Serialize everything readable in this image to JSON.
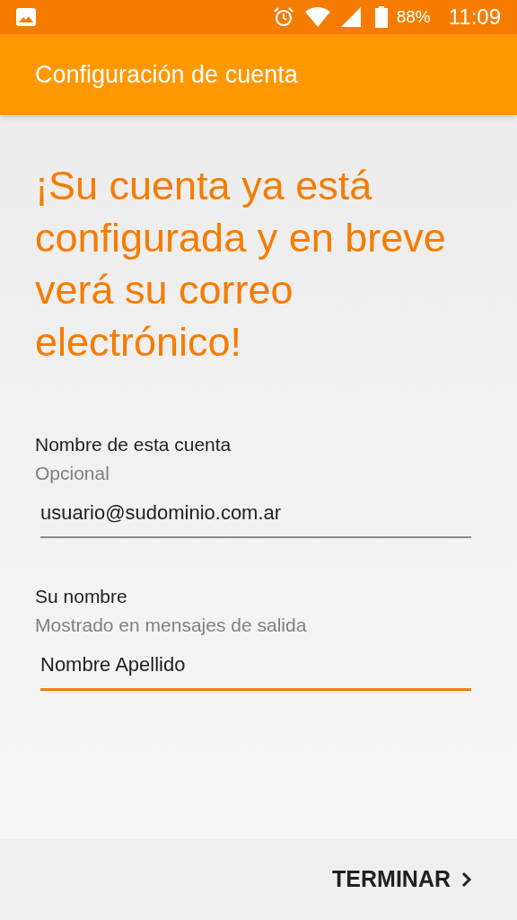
{
  "status_bar": {
    "battery": "88%",
    "time": "11:09"
  },
  "app_bar": {
    "title": "Configuración de cuenta"
  },
  "headline": "¡Su cuenta ya está configurada y en breve verá su correo electrónico!",
  "fields": [
    {
      "label": "Nombre de esta cuenta",
      "hint": "Opcional",
      "value": "usuario@sudominio.com.ar",
      "focused": false
    },
    {
      "label": "Su nombre",
      "hint": "Mostrado en mensajes de salida",
      "value": "Nombre Apellido",
      "focused": true
    }
  ],
  "footer": {
    "button": "TERMINAR"
  }
}
